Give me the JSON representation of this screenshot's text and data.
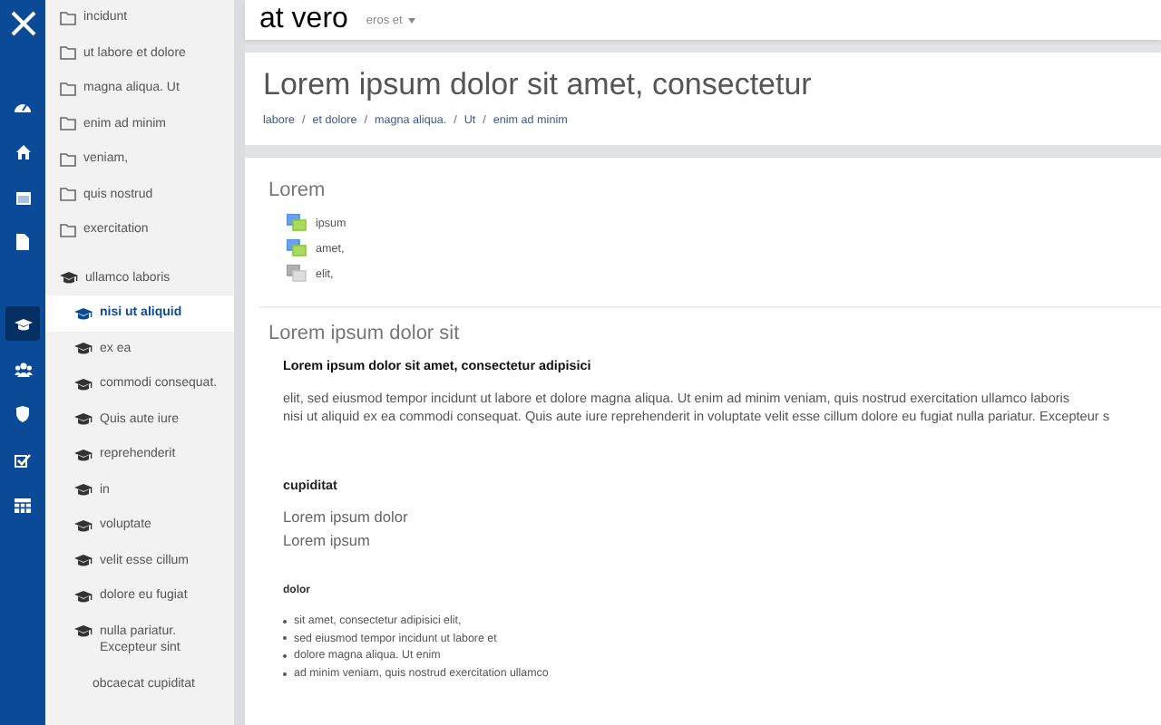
{
  "rail": {
    "items": [
      {
        "selected": false
      },
      {
        "selected": false
      },
      {
        "selected": false
      },
      {
        "selected": false
      },
      {
        "selected": true
      },
      {
        "selected": false
      },
      {
        "selected": false
      },
      {
        "selected": false
      },
      {
        "selected": false
      }
    ]
  },
  "sidebar": {
    "items": [
      {
        "label": "incidunt",
        "kind": "folder",
        "selected": false
      },
      {
        "label": "ut labore et dolore",
        "kind": "folder",
        "selected": false
      },
      {
        "label": "magna aliqua. Ut",
        "kind": "folder",
        "selected": false
      },
      {
        "label": "enim ad minim",
        "kind": "folder",
        "selected": false
      },
      {
        "label": "veniam,",
        "kind": "folder",
        "selected": false
      },
      {
        "label": "quis nostrud",
        "kind": "folder",
        "selected": false
      },
      {
        "label": "exercitation",
        "kind": "folder",
        "selected": false
      },
      {
        "label": "ullamco laboris",
        "kind": "course",
        "selected": false,
        "children": [
          {
            "label": "nisi ut aliquid",
            "kind": "course",
            "selected": true
          },
          {
            "label": "ex ea",
            "kind": "course",
            "selected": false
          },
          {
            "label": "commodi consequat.",
            "kind": "course",
            "selected": false
          },
          {
            "label": "Quis aute iure",
            "kind": "course",
            "selected": false
          },
          {
            "label": "reprehenderit",
            "kind": "course",
            "selected": false
          },
          {
            "label": "in",
            "kind": "course",
            "selected": false
          },
          {
            "label": "voluptate",
            "kind": "course",
            "selected": false
          },
          {
            "label": "velit esse cillum",
            "kind": "course",
            "selected": false
          },
          {
            "label": "dolore eu fugiat",
            "kind": "course",
            "selected": false
          },
          {
            "label": "nulla pariatur. Excepteur sint",
            "kind": "course",
            "selected": false
          },
          {
            "label": "obcaecat cupiditat",
            "kind": "plain",
            "selected": false
          }
        ]
      }
    ]
  },
  "topbar": {
    "brand": "at vero",
    "menu": "eros et"
  },
  "header": {
    "title": "Lorem ipsum dolor sit amet, consectetur",
    "separator": "/",
    "breadcrumbs": [
      "labore",
      "et dolore",
      "magna aliqua.",
      "Ut",
      "enim ad minim"
    ]
  },
  "forums": {
    "title": "Lorem",
    "items": [
      {
        "label": "ipsum",
        "kind": "unread"
      },
      {
        "label": "amet,",
        "kind": "unread"
      },
      {
        "label": "elit,",
        "kind": "read"
      }
    ]
  },
  "section": {
    "title": "Lorem ipsum dolor sit",
    "heading": "Lorem ipsum dolor sit amet, consectetur adipisici",
    "paragraph_lines": [
      "elit, sed eiusmod tempor incidunt ut labore et dolore magna aliqua. Ut enim ad minim veniam, quis nostrud exercitation ullamco laboris",
      "nisi ut aliquid ex ea commodi consequat. Quis aute iure reprehenderit in voluptate velit esse cillum dolore eu fugiat nulla pariatur. Excepteur s"
    ],
    "subheading": "cupiditat",
    "lines": [
      "Lorem ipsum dolor",
      "Lorem ipsum"
    ],
    "list_heading": "dolor",
    "bullets": [
      "sit amet, consectetur adipisici elit,",
      "sed eiusmod tempor incidunt ut labore et",
      "dolore magna aliqua. Ut enim",
      "ad minim veniam, quis nostrud exercitation ullamco"
    ]
  }
}
